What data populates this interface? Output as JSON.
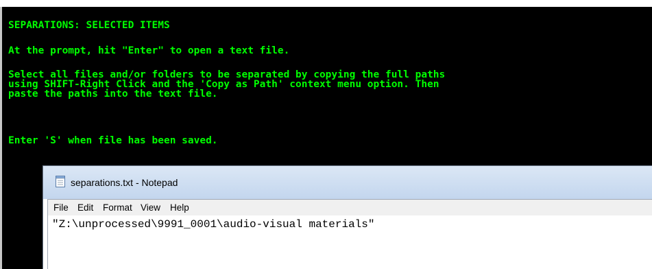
{
  "console": {
    "lines": [
      "SEPARATIONS: SELECTED ITEMS",
      "At the prompt, hit \"Enter\" to open a text file.",
      "Select all files and/or folders to be separated by copying the full paths",
      "using SHIFT-Right Click and the 'Copy as Path' context menu option. Then",
      "paste the paths into the text file.",
      "Enter 'S' when file has been saved."
    ],
    "text_color": "#00ff00",
    "background_color": "#000000"
  },
  "notepad": {
    "title": "separations.txt - Notepad",
    "icon": "notepad-icon",
    "menu": [
      "File",
      "Edit",
      "Format",
      "View",
      "Help"
    ],
    "content": "\"Z:\\unprocessed\\9991_0001\\audio-visual materials\""
  }
}
